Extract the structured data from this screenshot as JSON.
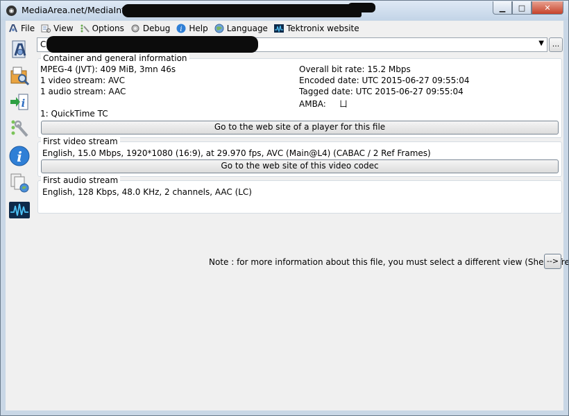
{
  "window": {
    "title": "MediaArea.net/MediaInfo - ",
    "minimize_glyph": "▁",
    "maximize_glyph": "□",
    "close_glyph": "✕"
  },
  "menu": {
    "items": [
      {
        "label": "File",
        "icon": "file-icon"
      },
      {
        "label": "View",
        "icon": "view-icon"
      },
      {
        "label": "Options",
        "icon": "options-icon"
      },
      {
        "label": "Debug",
        "icon": "debug-icon"
      },
      {
        "label": "Help",
        "icon": "help-icon"
      },
      {
        "label": "Language",
        "icon": "language-icon"
      },
      {
        "label": "Tektronix website",
        "icon": "tektronix-icon"
      }
    ]
  },
  "sidebar": {
    "buttons": [
      {
        "name": "open-file-icon"
      },
      {
        "name": "open-folder-icon"
      },
      {
        "name": "export-icon"
      },
      {
        "name": "preferences-icon"
      },
      {
        "name": "about-icon"
      },
      {
        "name": "knowledge-base-icon"
      },
      {
        "name": "tektronix-icon"
      }
    ]
  },
  "file_select": {
    "value": "C:\\",
    "arrow": "▼",
    "browse_label": "..."
  },
  "general": {
    "header": "Container and general information",
    "left_lines": [
      "MPEG-4 (JVT): 409 MiB, 3mn 46s",
      "1 video stream: AVC",
      "1 audio stream: AAC",
      "",
      "1: QuickTime TC"
    ],
    "right_lines": [
      "Overall bit rate: 15.2 Mbps",
      "Encoded date: UTC 2015-06-27 09:55:04",
      "Tagged date: UTC 2015-06-27 09:55:04",
      "AMBA:     ㄩ"
    ],
    "button_label": "Go to the web site of a player for this file"
  },
  "video": {
    "header": "First video stream",
    "description": "English, 15.0 Mbps, 1920*1080 (16:9), at 29.970 fps, AVC (Main@L4) (CABAC / 2 Ref Frames)",
    "button_label": "Go to the web site of this video codec"
  },
  "audio": {
    "header": "First audio stream",
    "description": "English, 128 Kbps, 48.0 KHz, 2 channels, AAC (LC)"
  },
  "note": {
    "text": "Note : for more information about this file, you must select a different view (Sheet, Tree...)",
    "button_label": "-->"
  }
}
